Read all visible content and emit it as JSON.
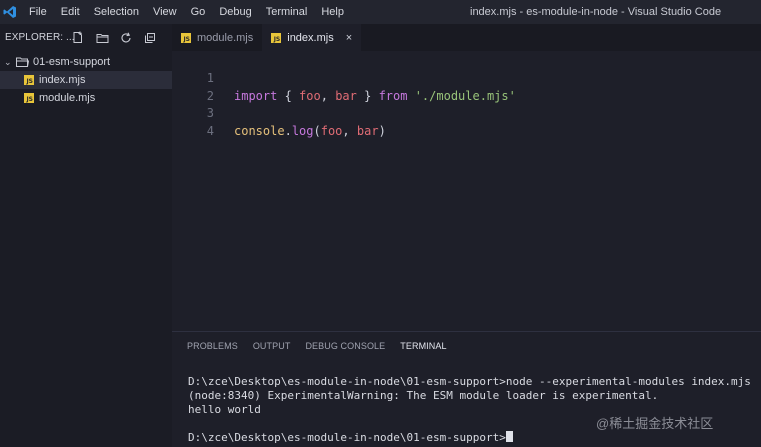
{
  "titlebar": {
    "menu": [
      "File",
      "Edit",
      "Selection",
      "View",
      "Go",
      "Debug",
      "Terminal",
      "Help"
    ],
    "window_title": "index.mjs - es-module-in-node - Visual Studio Code"
  },
  "sidebar": {
    "title": "EXPLORER: ...",
    "folder": "01-esm-support",
    "files": [
      "index.mjs",
      "module.mjs"
    ]
  },
  "tabs": [
    {
      "label": "module.mjs"
    },
    {
      "label": "index.mjs",
      "close": "×"
    }
  ],
  "editor": {
    "line_numbers": [
      "1",
      "2",
      "3",
      "4"
    ],
    "line1": {
      "import": "import",
      "ob": "{ ",
      "foo": "foo",
      "comma": ", ",
      "bar": "bar",
      "cb": " } ",
      "from": "from",
      "str": "'./module.mjs'"
    },
    "line3": {
      "console": "console",
      "dot": ".",
      "log": "log",
      "op": "(",
      "foo": "foo",
      "comma": ", ",
      "bar": "bar",
      "cp": ")"
    }
  },
  "panel": {
    "tabs": [
      "PROBLEMS",
      "OUTPUT",
      "DEBUG CONSOLE",
      "TERMINAL"
    ]
  },
  "terminal": {
    "lines": [
      "D:\\zce\\Desktop\\es-module-in-node\\01-esm-support>node --experimental-modules index.mjs",
      "(node:8340) ExperimentalWarning: The ESM module loader is experimental.",
      "hello world",
      "",
      "D:\\zce\\Desktop\\es-module-in-node\\01-esm-support>"
    ]
  },
  "watermark": "@稀土掘金技术社区",
  "colors": {
    "accent_js": "#e8c53a",
    "keyword": "#c678dd",
    "string": "#98c379",
    "variable": "#e06c75"
  }
}
